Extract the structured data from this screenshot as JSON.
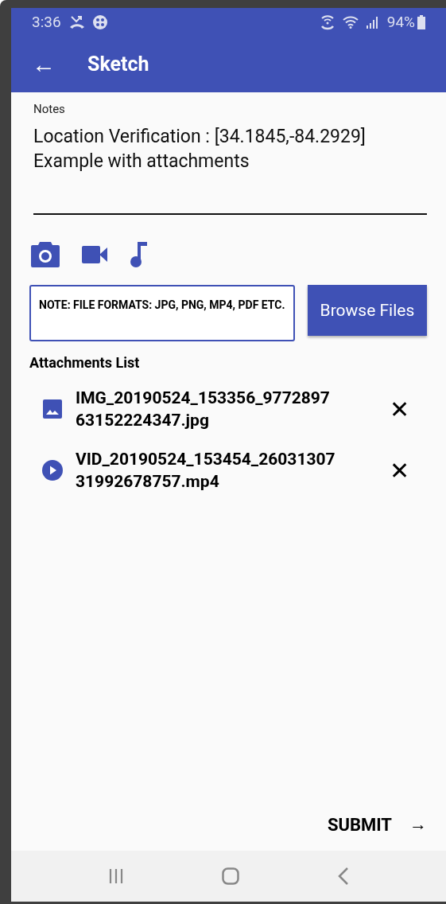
{
  "status_bar": {
    "time": "3:36",
    "battery": "94%"
  },
  "app_bar": {
    "back": "←",
    "title": "Sketch"
  },
  "notes": {
    "label": "Notes",
    "value": "Location Verification : [34.1845,-84.2929]\nExample with attachments"
  },
  "note_box": {
    "text": "NOTE: FILE FORMATS: JPG, PNG, MP4, PDF ETC."
  },
  "browse_button": "Browse Files",
  "attachments": {
    "title": "Attachments List",
    "items": [
      {
        "kind": "image",
        "name": "IMG_20190524_153356_9772897\n63152224347.jpg",
        "remove": "✕"
      },
      {
        "kind": "video",
        "name": "VID_20190524_153454_26031307\n31992678757.mp4",
        "remove": "✕"
      }
    ]
  },
  "submit": {
    "label": "SUBMIT",
    "arrow": "→"
  }
}
